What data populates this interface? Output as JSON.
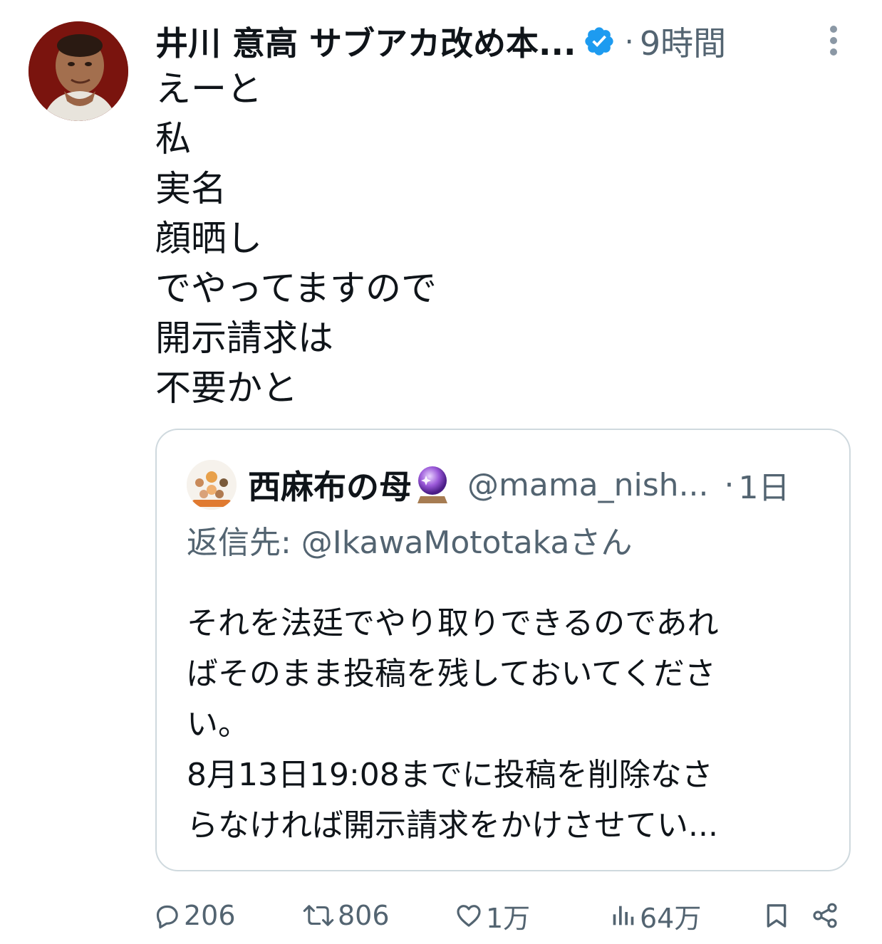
{
  "tweet": {
    "author_name": "井川 意高 サブアカ改め本...",
    "separator": "·",
    "time": "9時間",
    "lines": [
      "えーと",
      "私",
      "実名",
      "顔晒し",
      "でやってますので",
      "開示請求は",
      "不要かと"
    ]
  },
  "quote": {
    "author_name": "西麻布の母",
    "handle": "@mama_nish...",
    "separator": "·",
    "time": "1日",
    "reply_to": "返信先: @IkawaMototakaさん",
    "lines": [
      "それを法廷でやり取りできるのであれ",
      "ばそのまま投稿を残しておいてくださ",
      "い。",
      "8月13日19:08までに投稿を削除なさ",
      "らなければ開示請求をかけさせてい..."
    ]
  },
  "actions": {
    "reply_count": "206",
    "retweet_count": "806",
    "like_count": "1万",
    "view_count": "64万"
  },
  "colors": {
    "text_primary": "#0f1419",
    "text_secondary": "#536471",
    "verified_blue": "#1d9bf0",
    "card_border": "#cfd9de"
  },
  "icons": {
    "verified": "verified-badge-icon",
    "more": "more-vertical-icon",
    "crystal_ball": "crystal-ball-icon",
    "reply": "reply-icon",
    "retweet": "retweet-icon",
    "like": "heart-icon",
    "views": "views-icon",
    "bookmark": "bookmark-icon",
    "share": "share-icon"
  }
}
